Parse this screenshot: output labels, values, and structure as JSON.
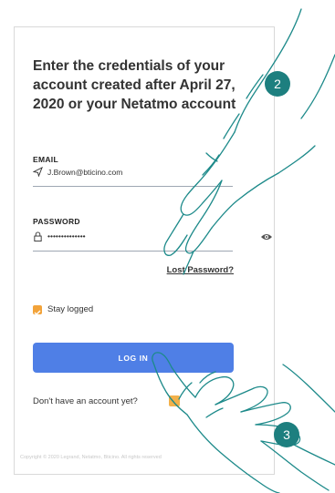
{
  "heading": "Enter the credentials of your account created after April 27, 2020 or your Netatmo account",
  "email": {
    "label": "EMAIL",
    "value": "J.Brown@bticino.com",
    "icon": "send-icon"
  },
  "password": {
    "label": "PASSWORD",
    "value": "••••••••••••••",
    "icon": "lock-icon",
    "toggle_icon": "eye-icon"
  },
  "lost_password": "Lost Password?",
  "stay_logged": {
    "label": "Stay logged",
    "checked": true
  },
  "login_button": "LOG IN",
  "no_account": "Don't have an account yet?",
  "copyright": "Copyright © 2020 Legrand, Netatmo, Bticino. All rights reserved",
  "steps": [
    "2",
    "3"
  ],
  "colors": {
    "accent": "#4f7fe6",
    "checkbox": "#f2a33a",
    "badge": "#1d7f7f",
    "hand_outline": "#1d8a8a"
  }
}
